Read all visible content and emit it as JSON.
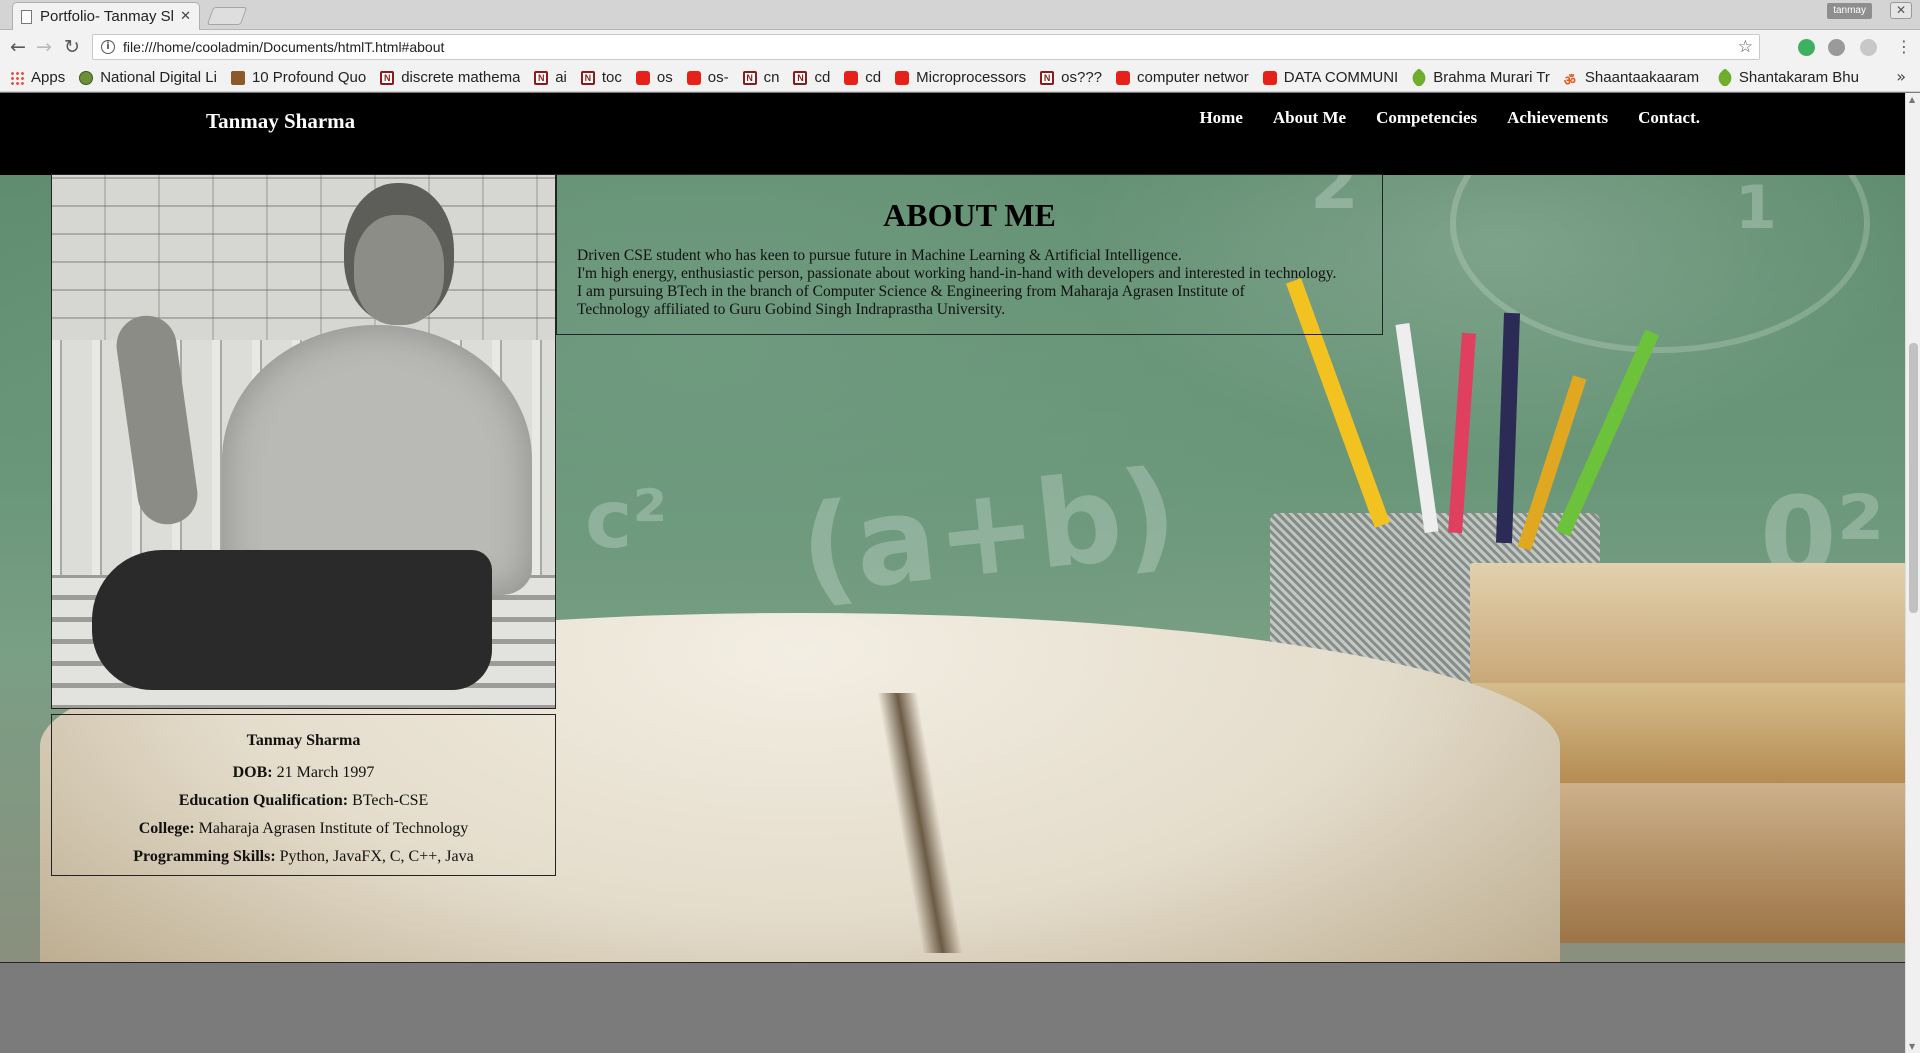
{
  "browser": {
    "tab_title": "Portfolio- Tanmay Sl",
    "tab_close": "✕",
    "profile_name": "tanmay",
    "window_close": "✕",
    "url": "file:///home/cooladmin/Documents/htmlT.html#about",
    "info_glyph": "i",
    "star_glyph": "☆",
    "menu_glyph": "⋮",
    "back_glyph": "←",
    "forward_glyph": "→",
    "reload_glyph": "↻"
  },
  "bookmarks": [
    {
      "label": "Apps",
      "icon": "apps-icon"
    },
    {
      "label": "National Digital Li",
      "icon": "globe-icon"
    },
    {
      "label": "10 Profound Quo",
      "icon": "book-icon"
    },
    {
      "label": "discrete mathema",
      "icon": "nptel-icon"
    },
    {
      "label": "ai",
      "icon": "nptel-icon"
    },
    {
      "label": "toc",
      "icon": "nptel-icon"
    },
    {
      "label": "os",
      "icon": "youtube-icon"
    },
    {
      "label": "os-",
      "icon": "youtube-icon"
    },
    {
      "label": "cn",
      "icon": "nptel-icon"
    },
    {
      "label": "cd",
      "icon": "nptel-icon"
    },
    {
      "label": "cd",
      "icon": "youtube-icon"
    },
    {
      "label": "Microprocessors",
      "icon": "youtube-icon"
    },
    {
      "label": "os???",
      "icon": "nptel-icon"
    },
    {
      "label": "computer networ",
      "icon": "youtube-icon"
    },
    {
      "label": "DATA COMMUNI",
      "icon": "youtube-icon"
    },
    {
      "label": "Brahma Murari Tr",
      "icon": "leaf-icon"
    },
    {
      "label": "Shaantaakaaram B",
      "icon": "om-icon"
    },
    {
      "label": "Shantakaram Bhu",
      "icon": "leaf-icon"
    }
  ],
  "bookmarks_more": "»",
  "site": {
    "brand": "Tanmay Sharma",
    "nav": [
      "Home",
      "About Me",
      "Competencies",
      "Achievements",
      "Contact."
    ]
  },
  "about": {
    "heading": "ABOUT ME",
    "lines": [
      "Driven CSE student who has keen to pursue future in Machine Learning & Artificial Intelligence.",
      "I'm high energy, enthusiastic person, passionate about working hand-in-hand with developers and interested in technology.",
      "I am pursuing BTech in the branch of Computer Science & Engineering from Maharaja Agrasen Institute of",
      "Technology affiliated to Guru Gobind Singh Indraprastha University."
    ]
  },
  "profile": {
    "name": "Tanmay Sharma",
    "dob_label": "DOB:",
    "dob_value": "21 March 1997",
    "edu_label": "Education Qualification:",
    "edu_value": "BTech-CSE",
    "college_label": "College:",
    "college_value": "Maharaja Agrasen Institute of Technology",
    "skills_label": "Programming Skills:",
    "skills_value": "Python, JavaFX, C, C++, Java"
  },
  "background_chalk": [
    "(a+b)",
    "c²",
    "0²",
    "2",
    "1"
  ],
  "colors": {
    "header_bg": "#000000",
    "chalkboard": "#6a977a",
    "page_bottom": "#7b7b7b"
  }
}
